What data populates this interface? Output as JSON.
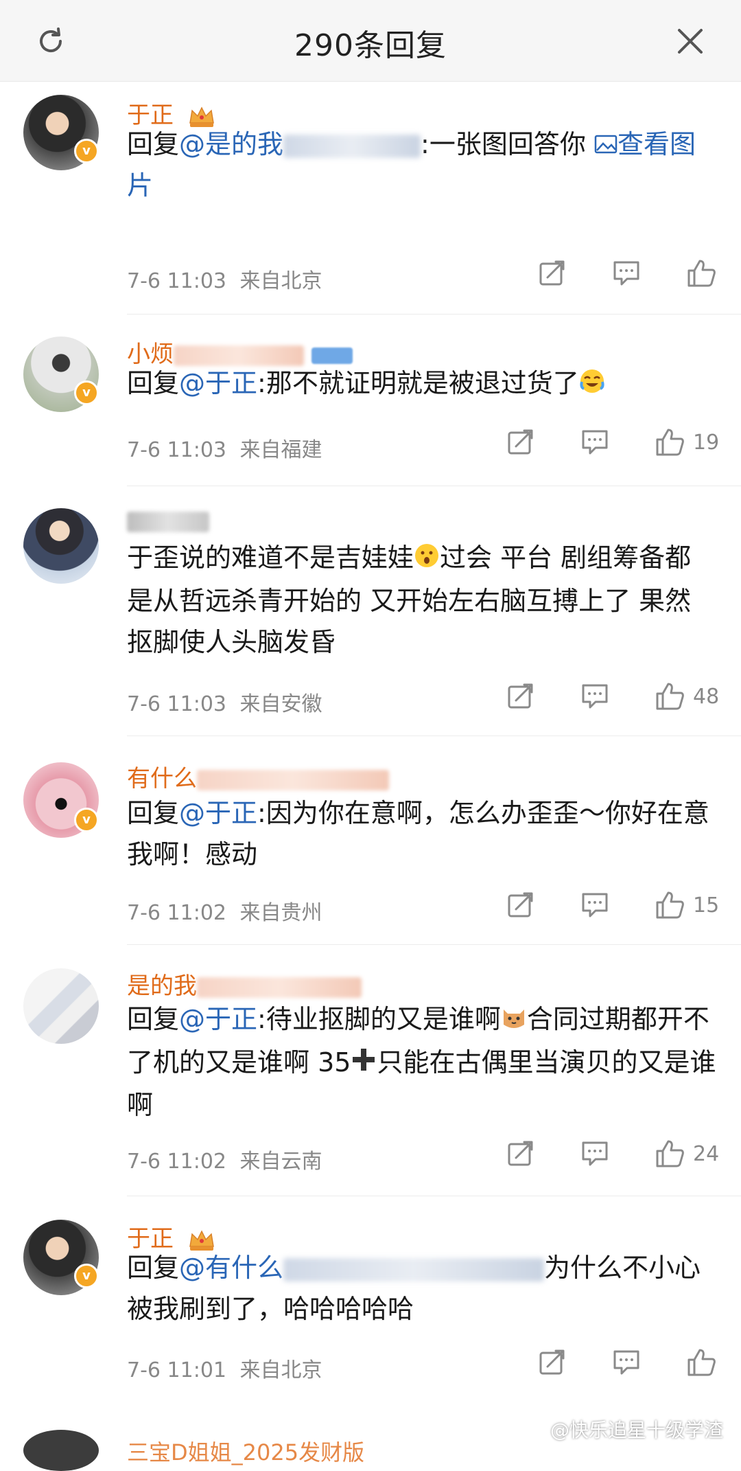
{
  "header": {
    "title": "290条回复"
  },
  "comments": [
    {
      "name": "于正",
      "text_prefix": "回复",
      "mention": "@是的我",
      "text_body": ":一张图回答你",
      "link": "查看图片",
      "time": "7-6 11:03",
      "location": "来自北京",
      "likes": ""
    },
    {
      "name": "小烦",
      "text_prefix": "回复",
      "mention": "@于正",
      "text_body": ":那不就证明就是被退过货了",
      "time": "7-6 11:03",
      "location": "来自福建",
      "likes": "19"
    },
    {
      "name": "",
      "text_body": "于歪说的难道不是吉娃娃",
      "text_body2": "过会 平台 剧组筹备都是从哲远杀青开始的 又开始左右脑互搏上了 果然抠脚使人头脑发昏",
      "time": "7-6 11:03",
      "location": "来自安徽",
      "likes": "48"
    },
    {
      "name": "有什么",
      "text_prefix": "回复",
      "mention": "@于正",
      "text_body": ":因为你在意啊，怎么办歪歪～你好在意我啊！感动",
      "time": "7-6 11:02",
      "location": "来自贵州",
      "likes": "15"
    },
    {
      "name": "是的我",
      "text_prefix": "回复",
      "mention": "@于正",
      "text_body": ":待业抠脚的又是谁啊",
      "text_body2": "合同过期都开不了机的又是谁啊 35",
      "text_body3": "只能在古偶里当演贝的又是谁啊",
      "time": "7-6 11:02",
      "location": "来自云南",
      "likes": "24"
    },
    {
      "name": "于正",
      "text_prefix": "回复",
      "mention": "@有什么",
      "text_body": "为什么不小心被我刷到了，哈哈哈哈哈",
      "time": "7-6 11:01",
      "location": "来自北京",
      "likes": ""
    }
  ],
  "next_peek": "三宝D姐姐_2025发财版",
  "watermark": "@快乐追星十级学渣",
  "colors": {
    "name": "#e06b1a",
    "mention": "#2a66b6",
    "meta": "#888888",
    "vbadge": "#f5a623"
  },
  "icons": {
    "refresh": "refresh-icon",
    "close": "close-icon",
    "repost": "repost-icon",
    "comment": "comment-icon",
    "like": "like-icon",
    "image": "image-icon",
    "crown": "crown-icon"
  }
}
